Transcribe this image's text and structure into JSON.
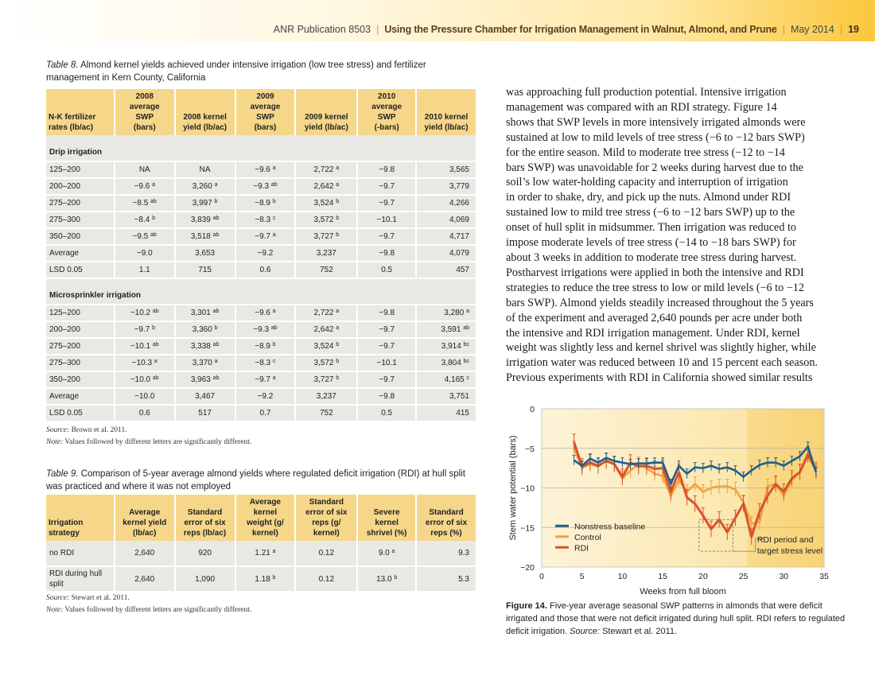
{
  "header": {
    "publication": "ANR Publication 8503",
    "title": "Using the Pressure Chamber for Irrigation Management in Walnut, Almond, and Prune",
    "date": "May 2014",
    "page": "19"
  },
  "table8": {
    "label": "Table 8.",
    "caption": "Almond kernel yields achieved under intensive irrigation (low tree stress) and fertilizer management in Kern County, California",
    "headers": [
      [
        "N-K fertilizer",
        "rates (lb/ac)"
      ],
      [
        "2008",
        "average",
        "SWP",
        "(bars)"
      ],
      [
        "2008 kernel",
        "yield (lb/ac)"
      ],
      [
        "2009",
        "average",
        "SWP",
        "(bars)"
      ],
      [
        "2009 kernel",
        "yield (lb/ac)"
      ],
      [
        "2010",
        "average",
        "SWP",
        "(-bars)"
      ],
      [
        "2010 kernel",
        "yield (lb/ac)"
      ]
    ],
    "sections": [
      {
        "title": "Drip irrigation",
        "rows": [
          [
            [
              "125–200",
              ""
            ],
            [
              "NA",
              ""
            ],
            [
              "NA",
              ""
            ],
            [
              "−9.6",
              "a"
            ],
            [
              "2,722",
              "a"
            ],
            [
              "−9.8",
              ""
            ],
            [
              "3,565",
              ""
            ]
          ],
          [
            [
              "200–200",
              ""
            ],
            [
              "−9.6",
              "a"
            ],
            [
              "3,260",
              "a"
            ],
            [
              "−9.3",
              "ab"
            ],
            [
              "2,642",
              "a"
            ],
            [
              "−9.7",
              ""
            ],
            [
              "3,779",
              ""
            ]
          ],
          [
            [
              "275–200",
              ""
            ],
            [
              "−8.5",
              "ab"
            ],
            [
              "3,997",
              "b"
            ],
            [
              "−8.9",
              "b"
            ],
            [
              "3,524",
              "b"
            ],
            [
              "−9.7",
              ""
            ],
            [
              "4,266",
              ""
            ]
          ],
          [
            [
              "275–300",
              ""
            ],
            [
              "−8.4",
              "b"
            ],
            [
              "3,839",
              "ab"
            ],
            [
              "−8.3",
              "c"
            ],
            [
              "3,572",
              "b"
            ],
            [
              "−10.1",
              ""
            ],
            [
              "4,069",
              ""
            ]
          ],
          [
            [
              "350–200",
              ""
            ],
            [
              "−9.5",
              "ab"
            ],
            [
              "3,518",
              "ab"
            ],
            [
              "−9.7",
              "a"
            ],
            [
              "3,727",
              "b"
            ],
            [
              "−9.7",
              ""
            ],
            [
              "4,717",
              ""
            ]
          ],
          [
            [
              "Average",
              ""
            ],
            [
              "−9.0",
              ""
            ],
            [
              "3,653",
              ""
            ],
            [
              "−9.2",
              ""
            ],
            [
              "3,237",
              ""
            ],
            [
              "−9.8",
              ""
            ],
            [
              "4,079",
              ""
            ]
          ],
          [
            [
              "LSD 0.05",
              ""
            ],
            [
              "1.1",
              ""
            ],
            [
              "715",
              ""
            ],
            [
              "0.6",
              ""
            ],
            [
              "752",
              ""
            ],
            [
              "0.5",
              ""
            ],
            [
              "457",
              ""
            ]
          ]
        ]
      },
      {
        "title": "Microsprinkler irrigation",
        "rows": [
          [
            [
              "125–200",
              ""
            ],
            [
              "−10.2",
              "ab"
            ],
            [
              "3,301",
              "ab"
            ],
            [
              "−9.6",
              "a"
            ],
            [
              "2,722",
              "a"
            ],
            [
              "−9.8",
              ""
            ],
            [
              "3,280",
              "a"
            ]
          ],
          [
            [
              "200–200",
              ""
            ],
            [
              "−9.7",
              "b"
            ],
            [
              "3,360",
              "b"
            ],
            [
              "−9.3",
              "ab"
            ],
            [
              "2,642",
              "a"
            ],
            [
              "−9.7",
              ""
            ],
            [
              "3,591",
              "ab"
            ]
          ],
          [
            [
              "275–200",
              ""
            ],
            [
              "−10.1",
              "ab"
            ],
            [
              "3,338",
              "ab"
            ],
            [
              "−8.9",
              "b"
            ],
            [
              "3,524",
              "b"
            ],
            [
              "−9.7",
              ""
            ],
            [
              "3,914",
              "bc"
            ]
          ],
          [
            [
              "275–300",
              ""
            ],
            [
              "−10.3",
              "a"
            ],
            [
              "3,370",
              "a"
            ],
            [
              "−8.3",
              "c"
            ],
            [
              "3,572",
              "b"
            ],
            [
              "−10.1",
              ""
            ],
            [
              "3,804",
              "bc"
            ]
          ],
          [
            [
              "350–200",
              ""
            ],
            [
              "−10.0",
              "ab"
            ],
            [
              "3,963",
              "ab"
            ],
            [
              "−9.7",
              "a"
            ],
            [
              "3,727",
              "b"
            ],
            [
              "−9.7",
              ""
            ],
            [
              "4,165",
              "c"
            ]
          ],
          [
            [
              "Average",
              ""
            ],
            [
              "−10.0",
              ""
            ],
            [
              "3,467",
              ""
            ],
            [
              "−9.2",
              ""
            ],
            [
              "3,237",
              ""
            ],
            [
              "−9.8",
              ""
            ],
            [
              "3,751",
              ""
            ]
          ],
          [
            [
              "LSD 0.05",
              ""
            ],
            [
              "0.6",
              ""
            ],
            [
              "517",
              ""
            ],
            [
              "0.7",
              ""
            ],
            [
              "752",
              ""
            ],
            [
              "0.5",
              ""
            ],
            [
              "415",
              ""
            ]
          ]
        ]
      }
    ],
    "source_label": "Source:",
    "source": "Brown et al. 2011.",
    "note_label": "Note:",
    "note": "Values followed by different letters are significantly different."
  },
  "table9": {
    "label": "Table 9.",
    "caption": "Comparison of 5-year average almond yields where regulated deficit irrigation (RDI) at hull split was practiced and where it was not employed",
    "headers": [
      [
        "Irrigation",
        "strategy"
      ],
      [
        "Average",
        "kernel yield",
        "(lb/ac)"
      ],
      [
        "Standard",
        "error of six",
        "reps (lb/ac)"
      ],
      [
        "Average",
        "kernel",
        "weight (g/",
        "kernel)"
      ],
      [
        "Standard",
        "error of six",
        "reps (g/",
        "kernel)"
      ],
      [
        "Severe",
        "kernel",
        "shrivel (%)"
      ],
      [
        "Standard",
        "error of six",
        "reps (%)"
      ]
    ],
    "rows": [
      [
        [
          "no RDI",
          ""
        ],
        [
          "2,640",
          ""
        ],
        [
          "920",
          ""
        ],
        [
          "1.21",
          "a"
        ],
        [
          "0.12",
          ""
        ],
        [
          "9.0",
          "a"
        ],
        [
          "9.3",
          ""
        ]
      ],
      [
        [
          "RDI during hull split",
          ""
        ],
        [
          "2,640",
          ""
        ],
        [
          "1,090",
          ""
        ],
        [
          "1.18",
          "b"
        ],
        [
          "0.12",
          ""
        ],
        [
          "13.0",
          "b"
        ],
        [
          "5.3",
          ""
        ]
      ]
    ],
    "source_label": "Source:",
    "source": "Stewart et al. 2011.",
    "note_label": "Note:",
    "note": "Values followed by different letters are significantly different."
  },
  "body_lines": [
    "was approaching full production potential. Intensive irrigation",
    "management was compared with an RDI strategy. Figure 14",
    "shows that SWP levels in more intensively irrigated almonds were",
    "sustained at low to mild levels of tree stress (−6 to −12 bars SWP)",
    "for the entire season. Mild to moderate tree stress (−12 to −14",
    "bars SWP) was unavoidable for 2 weeks during harvest due to the",
    "soil’s low water-holding capacity and interruption of irrigation",
    "in order to shake, dry, and pick up the nuts. Almond under RDI",
    "sustained low to mild tree stress (−6 to −12 bars SWP) up to the",
    "onset of hull split in midsummer. Then irrigation was reduced to",
    "impose moderate levels of tree stress (−14 to −18 bars SWP) for",
    "about 3 weeks in addition to moderate tree stress during harvest.",
    "Postharvest irrigations were applied in both the intensive and RDI",
    "strategies to reduce the tree stress to low or mild levels (−6 to −12",
    "bars SWP). Almond yields steadily increased throughout the 5 years",
    "of the experiment and averaged 2,640 pounds per acre under both",
    "the intensive and RDI irrigation management. Under RDI, kernel",
    "weight was slightly less and kernel shrivel was slightly higher, while",
    "irrigation water was reduced between 10 and 15 percent each season.",
    "Previous experiments with RDI in California showed similar results"
  ],
  "figure": {
    "label": "Figure 14.",
    "caption": "Five-year average seasonal SWP patterns in almonds that were deficit irrigated and those that were not deficit irrigated during hull split. RDI refers to regulated deficit irrigation.",
    "source_label": "Source:",
    "source": "Stewart et al. 2011."
  },
  "chart_data": {
    "type": "line",
    "xlabel": "Weeks from full bloom",
    "ylabel": "Stem water potential (bars)",
    "xlim": [
      0,
      35
    ],
    "ylim": [
      -20,
      0
    ],
    "xticks": [
      "0",
      "5",
      "10",
      "15",
      "20",
      "25",
      "30",
      "35"
    ],
    "yticks": [
      "0",
      "−5",
      "−10",
      "−15",
      "−20"
    ],
    "grid": true,
    "legend_position": "bottom-left",
    "annotation": "RDI period and target stress level",
    "colors": {
      "nonstress": "#1f5f8b",
      "control": "#f2a33a",
      "rdi": "#d9532b",
      "bg_light": "#fdf3d8",
      "bg_dark": "#f9d77e"
    },
    "series": [
      {
        "name": "Nonstress baseline",
        "x": [
          4,
          5,
          6,
          7,
          8,
          9,
          10,
          11,
          12,
          13,
          14,
          15,
          16,
          17,
          18,
          19,
          20,
          21,
          22,
          23,
          24,
          25,
          26,
          27,
          28,
          29,
          30,
          31,
          32,
          33,
          34
        ],
        "y": [
          -6.5,
          -7.2,
          -6.3,
          -6.8,
          -6.2,
          -6.6,
          -6.8,
          -7.0,
          -6.9,
          -6.9,
          -6.8,
          -6.8,
          -9.5,
          -7.2,
          -8.2,
          -7.4,
          -7.5,
          -7.2,
          -7.6,
          -7.4,
          -7.8,
          -8.6,
          -7.8,
          -7.1,
          -6.8,
          -6.8,
          -7.2,
          -6.6,
          -6.0,
          -4.8,
          -8.0
        ]
      },
      {
        "name": "Control",
        "x": [
          4,
          5,
          6,
          7,
          8,
          9,
          10,
          11,
          12,
          13,
          14,
          15,
          16,
          17,
          18,
          19,
          20,
          21,
          22,
          23,
          24,
          25,
          26,
          27,
          28,
          29,
          30,
          31,
          32,
          33,
          34
        ],
        "y": [
          -5.0,
          -7.5,
          -7.0,
          -7.3,
          -6.5,
          -7.0,
          -8.8,
          -7.8,
          -7.0,
          -7.5,
          -8.2,
          -8.5,
          -11.0,
          -9.0,
          -10.5,
          -9.5,
          -10.5,
          -10.0,
          -9.8,
          -9.8,
          -10.2,
          -11.8,
          -14.5,
          -14.3,
          -9.8,
          -9.5,
          -11.0,
          -9.0,
          -8.0,
          -5.5,
          -8.0
        ]
      },
      {
        "name": "RDI",
        "x": [
          4,
          5,
          6,
          7,
          8,
          9,
          10,
          11,
          12,
          13,
          14,
          15,
          16,
          17,
          18,
          19,
          20,
          21,
          22,
          23,
          24,
          25,
          26,
          27,
          28,
          29,
          30,
          31,
          32,
          33,
          34
        ],
        "y": [
          -4.2,
          -7.3,
          -6.8,
          -7.2,
          -6.6,
          -7.0,
          -8.6,
          -6.8,
          -7.3,
          -7.2,
          -7.6,
          -7.5,
          -10.5,
          -8.0,
          -11.2,
          -12.0,
          -13.5,
          -15.2,
          -14.0,
          -15.6,
          -13.8,
          -12.0,
          -16.2,
          -13.0,
          -11.0,
          -9.5,
          -10.5,
          -8.8,
          -8.0,
          -5.8,
          -7.8
        ]
      }
    ]
  }
}
